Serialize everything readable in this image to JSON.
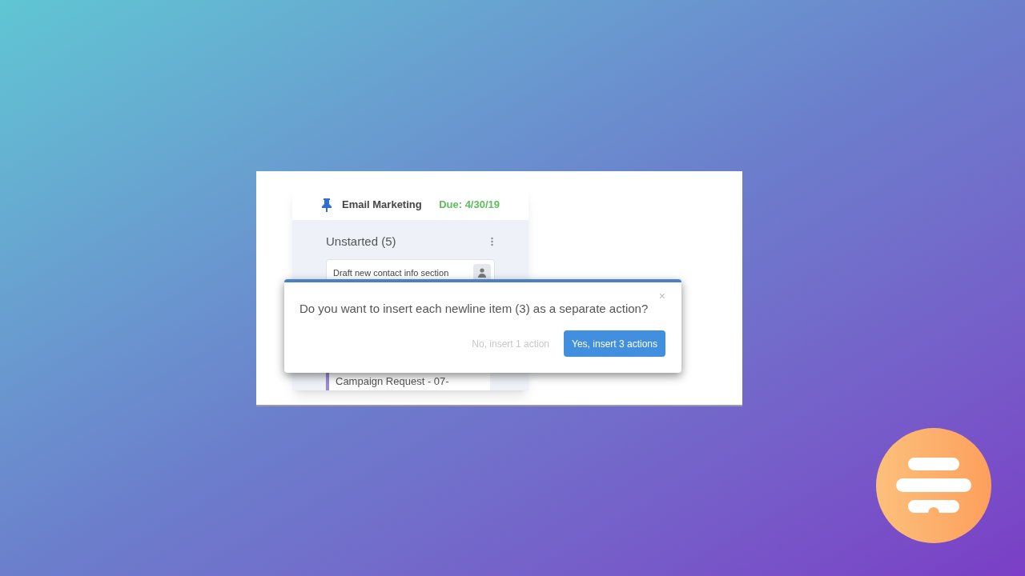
{
  "board": {
    "title": "Email Marketing",
    "due": "Due: 4/30/19",
    "column": {
      "title": "Unstarted (5)",
      "cards": [
        {
          "title": "Draft new contact info section",
          "kind": "assigned"
        },
        {
          "title": "Campaign Request - 07-",
          "kind": "striped"
        }
      ]
    }
  },
  "dialog": {
    "message": "Do you want to insert each newline item (3) as a separate action?",
    "close": "×",
    "buttons": [
      {
        "label": "No, insert 1 action",
        "kind": "secondary"
      },
      {
        "label": "Yes, insert 3 actions",
        "kind": "primary"
      }
    ]
  }
}
